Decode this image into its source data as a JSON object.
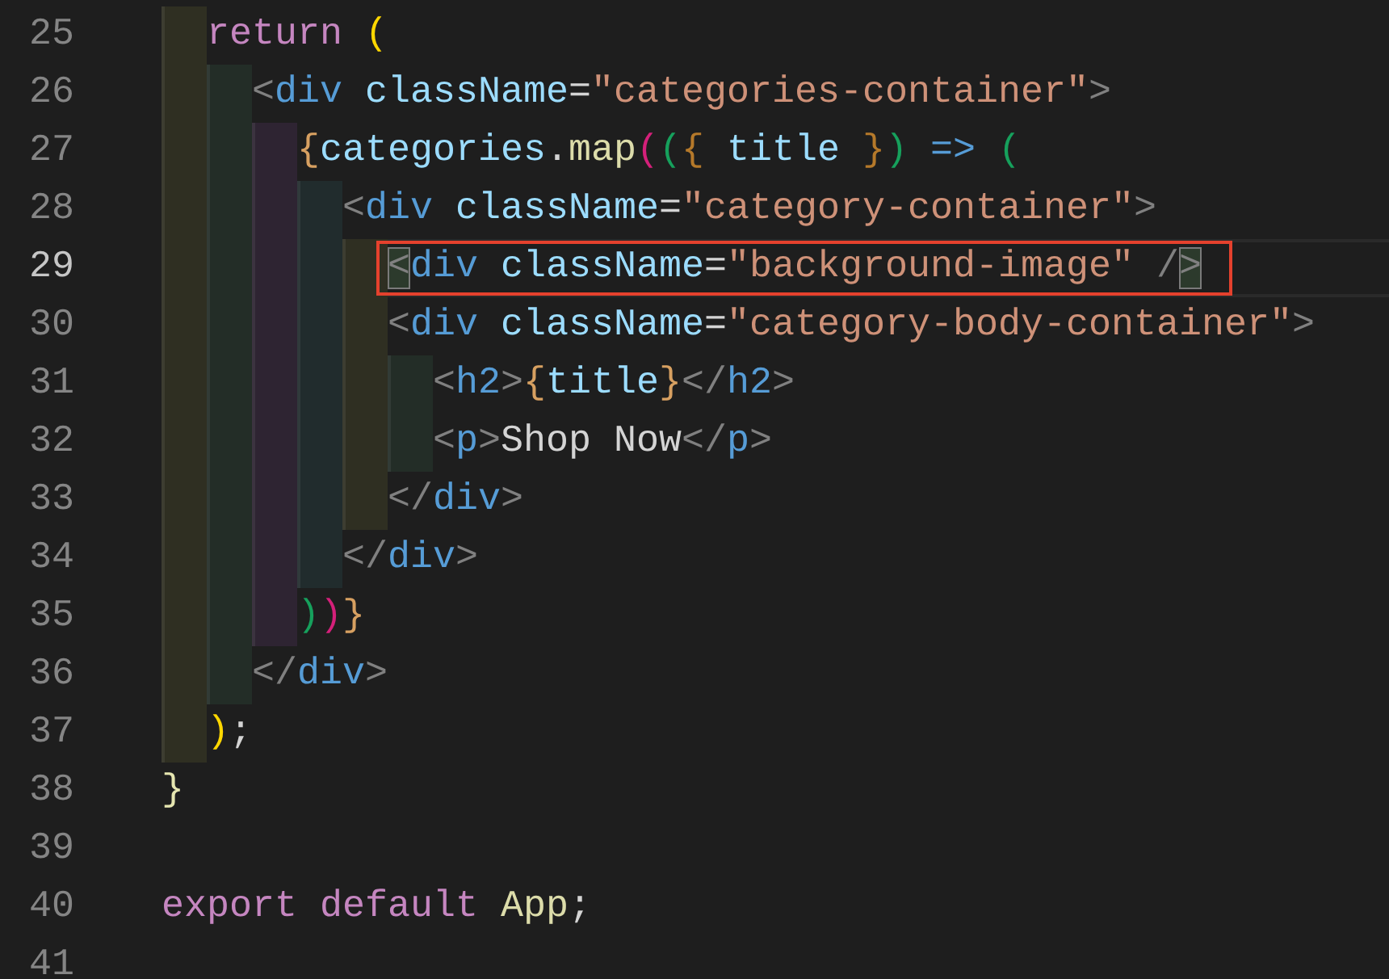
{
  "editor": {
    "lines": [
      {
        "number": "25",
        "current": false,
        "marked": false,
        "guides": [
          {
            "color": "#2f2f22"
          }
        ],
        "tokens": [
          {
            "kind": "keyword",
            "text": "return"
          },
          {
            "kind": "bracket",
            "color": "#ffd700",
            "text": " ("
          }
        ]
      },
      {
        "number": "26",
        "current": false,
        "marked": false,
        "guides": [
          {
            "color": "#2f2f22"
          },
          {
            "color": "#232d27"
          }
        ],
        "tokens": [
          {
            "kind": "tag-punct",
            "text": "<"
          },
          {
            "kind": "tag",
            "text": "div"
          },
          {
            "kind": "attr",
            "text": " className"
          },
          {
            "kind": "plain",
            "text": "="
          },
          {
            "kind": "string",
            "text": "\"categories-container\""
          },
          {
            "kind": "tag-punct",
            "text": ">"
          }
        ]
      },
      {
        "number": "27",
        "current": false,
        "marked": false,
        "guides": [
          {
            "color": "#2f2f22"
          },
          {
            "color": "#232d27"
          },
          {
            "color": "#2e2432"
          }
        ],
        "tokens": [
          {
            "kind": "bracket",
            "color": "#d7a061",
            "text": "{"
          },
          {
            "kind": "variable",
            "text": "categories"
          },
          {
            "kind": "plain",
            "text": "."
          },
          {
            "kind": "function",
            "text": "map"
          },
          {
            "kind": "bracket",
            "color": "#d4207a",
            "text": "("
          },
          {
            "kind": "bracket",
            "color": "#16a05c",
            "text": "("
          },
          {
            "kind": "bracket",
            "color": "#b5792a",
            "text": "{"
          },
          {
            "kind": "variable",
            "text": " title"
          },
          {
            "kind": "bracket",
            "color": "#b5792a",
            "text": " }"
          },
          {
            "kind": "bracket",
            "color": "#16a05c",
            "text": ")"
          },
          {
            "kind": "tag",
            "text": " =>"
          },
          {
            "kind": "bracket",
            "color": "#16a05c",
            "text": " ("
          }
        ]
      },
      {
        "number": "28",
        "current": false,
        "marked": false,
        "guides": [
          {
            "color": "#2f2f22"
          },
          {
            "color": "#232d27"
          },
          {
            "color": "#2e2432"
          },
          {
            "color": "#212c2d"
          }
        ],
        "tokens": [
          {
            "kind": "tag-punct",
            "text": "<"
          },
          {
            "kind": "tag",
            "text": "div"
          },
          {
            "kind": "attr",
            "text": " className"
          },
          {
            "kind": "plain",
            "text": "="
          },
          {
            "kind": "string",
            "text": "\"category-container\""
          },
          {
            "kind": "tag-punct",
            "text": ">"
          }
        ]
      },
      {
        "number": "29",
        "current": true,
        "marked": true,
        "guides": [
          {
            "color": "#2f2f22"
          },
          {
            "color": "#232d27"
          },
          {
            "color": "#2e2432"
          },
          {
            "color": "#212c2d"
          },
          {
            "color": "#2f2f22"
          }
        ],
        "tokens": [
          {
            "kind": "tag-punct-matched",
            "text": "<"
          },
          {
            "kind": "tag",
            "text": "div"
          },
          {
            "kind": "attr",
            "text": " className"
          },
          {
            "kind": "plain",
            "text": "="
          },
          {
            "kind": "string",
            "text": "\"background-image\""
          },
          {
            "kind": "tag-punct",
            "text": " /"
          },
          {
            "kind": "tag-punct-matched",
            "text": ">"
          }
        ]
      },
      {
        "number": "30",
        "current": false,
        "marked": false,
        "guides": [
          {
            "color": "#2f2f22"
          },
          {
            "color": "#232d27"
          },
          {
            "color": "#2e2432"
          },
          {
            "color": "#212c2d"
          },
          {
            "color": "#2f2f22"
          }
        ],
        "tokens": [
          {
            "kind": "tag-punct",
            "text": "<"
          },
          {
            "kind": "tag",
            "text": "div"
          },
          {
            "kind": "attr",
            "text": " className"
          },
          {
            "kind": "plain",
            "text": "="
          },
          {
            "kind": "string",
            "text": "\"category-body-container\""
          },
          {
            "kind": "tag-punct",
            "text": ">"
          }
        ]
      },
      {
        "number": "31",
        "current": false,
        "marked": false,
        "guides": [
          {
            "color": "#2f2f22"
          },
          {
            "color": "#232d27"
          },
          {
            "color": "#2e2432"
          },
          {
            "color": "#212c2d"
          },
          {
            "color": "#2f2f22"
          },
          {
            "color": "#232d27"
          }
        ],
        "tokens": [
          {
            "kind": "tag-punct",
            "text": "<"
          },
          {
            "kind": "tag",
            "text": "h2"
          },
          {
            "kind": "tag-punct",
            "text": ">"
          },
          {
            "kind": "bracket",
            "color": "#d7a061",
            "text": "{"
          },
          {
            "kind": "variable",
            "text": "title"
          },
          {
            "kind": "bracket",
            "color": "#d7a061",
            "text": "}"
          },
          {
            "kind": "tag-punct",
            "text": "</"
          },
          {
            "kind": "tag",
            "text": "h2"
          },
          {
            "kind": "tag-punct",
            "text": ">"
          }
        ]
      },
      {
        "number": "32",
        "current": false,
        "marked": false,
        "guides": [
          {
            "color": "#2f2f22"
          },
          {
            "color": "#232d27"
          },
          {
            "color": "#2e2432"
          },
          {
            "color": "#212c2d"
          },
          {
            "color": "#2f2f22"
          },
          {
            "color": "#232d27"
          }
        ],
        "tokens": [
          {
            "kind": "tag-punct",
            "text": "<"
          },
          {
            "kind": "tag",
            "text": "p"
          },
          {
            "kind": "tag-punct",
            "text": ">"
          },
          {
            "kind": "plain",
            "text": "Shop Now"
          },
          {
            "kind": "tag-punct",
            "text": "</"
          },
          {
            "kind": "tag",
            "text": "p"
          },
          {
            "kind": "tag-punct",
            "text": ">"
          }
        ]
      },
      {
        "number": "33",
        "current": false,
        "marked": false,
        "guides": [
          {
            "color": "#2f2f22"
          },
          {
            "color": "#232d27"
          },
          {
            "color": "#2e2432"
          },
          {
            "color": "#212c2d"
          },
          {
            "color": "#2f2f22"
          }
        ],
        "tokens": [
          {
            "kind": "tag-punct",
            "text": "</"
          },
          {
            "kind": "tag",
            "text": "div"
          },
          {
            "kind": "tag-punct",
            "text": ">"
          }
        ]
      },
      {
        "number": "34",
        "current": false,
        "marked": false,
        "guides": [
          {
            "color": "#2f2f22"
          },
          {
            "color": "#232d27"
          },
          {
            "color": "#2e2432"
          },
          {
            "color": "#212c2d"
          }
        ],
        "tokens": [
          {
            "kind": "tag-punct",
            "text": "</"
          },
          {
            "kind": "tag",
            "text": "div"
          },
          {
            "kind": "tag-punct",
            "text": ">"
          }
        ]
      },
      {
        "number": "35",
        "current": false,
        "marked": false,
        "guides": [
          {
            "color": "#2f2f22"
          },
          {
            "color": "#232d27"
          },
          {
            "color": "#2e2432"
          }
        ],
        "tokens": [
          {
            "kind": "bracket",
            "color": "#16a05c",
            "text": ")"
          },
          {
            "kind": "bracket",
            "color": "#d4207a",
            "text": ")"
          },
          {
            "kind": "bracket",
            "color": "#d7a061",
            "text": "}"
          }
        ]
      },
      {
        "number": "36",
        "current": false,
        "marked": false,
        "guides": [
          {
            "color": "#2f2f22"
          },
          {
            "color": "#232d27"
          }
        ],
        "tokens": [
          {
            "kind": "tag-punct",
            "text": "</"
          },
          {
            "kind": "tag",
            "text": "div"
          },
          {
            "kind": "tag-punct",
            "text": ">"
          }
        ]
      },
      {
        "number": "37",
        "current": false,
        "marked": false,
        "guides": [
          {
            "color": "#2f2f22"
          }
        ],
        "tokens": [
          {
            "kind": "bracket",
            "color": "#ffd700",
            "text": ")"
          },
          {
            "kind": "plain",
            "text": ";"
          }
        ]
      },
      {
        "number": "38",
        "current": false,
        "marked": false,
        "tokens": [
          {
            "kind": "bracket",
            "color": "#e6e6b0",
            "text": "}"
          }
        ]
      },
      {
        "number": "39",
        "current": false,
        "marked": false
      },
      {
        "number": "40",
        "current": false,
        "marked": false,
        "tokens": [
          {
            "kind": "keyword",
            "text": "export"
          },
          {
            "kind": "keyword",
            "text": " default"
          },
          {
            "kind": "function",
            "text": " App"
          },
          {
            "kind": "plain",
            "text": ";"
          }
        ]
      },
      {
        "number": "41",
        "current": false,
        "marked": false
      }
    ]
  }
}
